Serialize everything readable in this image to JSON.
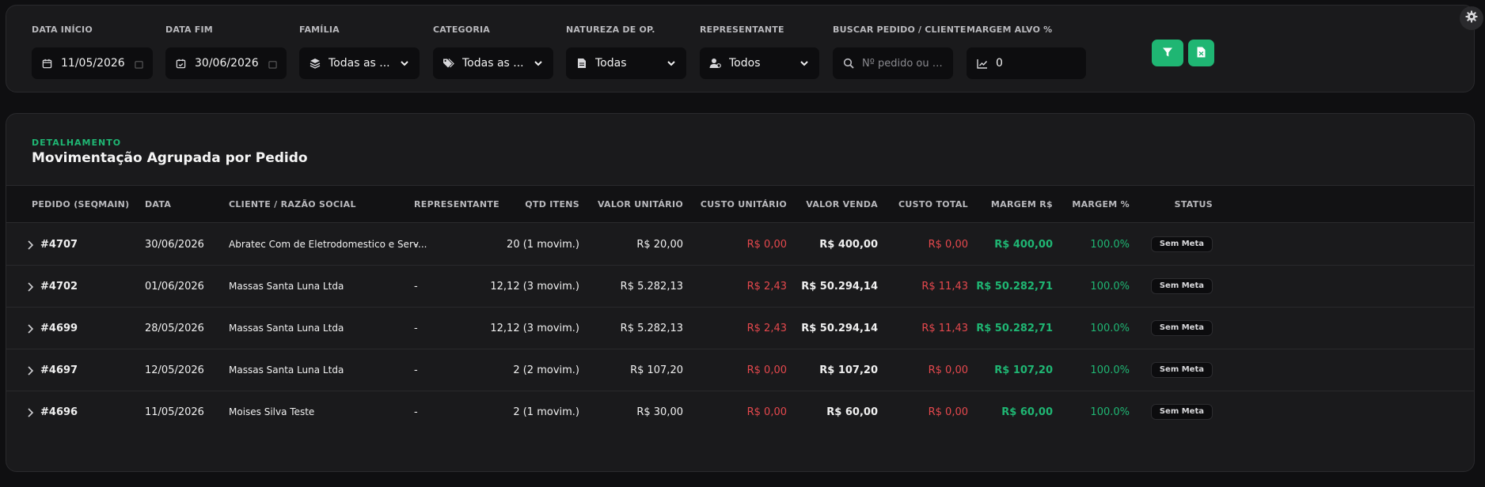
{
  "filters": {
    "data_inicio": {
      "label": "DATA INÍCIO",
      "value": "11/05/2026"
    },
    "data_fim": {
      "label": "DATA FIM",
      "value": "30/06/2026"
    },
    "familia": {
      "label": "FAMÍLIA",
      "value": "Todas as ..."
    },
    "categoria": {
      "label": "CATEGORIA",
      "value": "Todas as ..."
    },
    "natureza": {
      "label": "NATUREZA DE OP.",
      "value": "Todas"
    },
    "representante": {
      "label": "REPRESENTANTE",
      "value": "Todos"
    },
    "buscar": {
      "label": "BUSCAR PEDIDO / CLIENTE",
      "placeholder": "Nº pedido ou nome..."
    },
    "margem": {
      "label": "MARGEM ALVO %",
      "value": "0"
    }
  },
  "actions": {
    "filter_icon": "filter-icon",
    "export_icon": "excel-file-icon"
  },
  "theme": {
    "accent": "#1fb673",
    "danger": "#e5484d",
    "background": "#0f0f11",
    "card": "#1a1a1c"
  },
  "table": {
    "eyebrow": "DETALHAMENTO",
    "title": "Movimentação Agrupada por Pedido",
    "columns": {
      "pedido": "PEDIDO (SEQMAIN)",
      "data": "DATA",
      "cliente": "CLIENTE / RAZÃO SOCIAL",
      "representante": "REPRESENTANTE",
      "qtd": "QTD ITENS",
      "valor_unit": "VALOR UNITÁRIO",
      "custo_unit": "CUSTO UNITÁRIO",
      "valor_venda": "VALOR VENDA",
      "custo_total": "CUSTO TOTAL",
      "margem_rs": "MARGEM R$",
      "margem_pct": "MARGEM %",
      "status": "STATUS"
    },
    "rows": [
      {
        "pedido": "#4707",
        "data": "30/06/2026",
        "cliente": "Abratec Com de Eletrodomestico e Serv...",
        "representante": "-",
        "qtd": "20 (1 movim.)",
        "valor_unit": "R$ 20,00",
        "custo_unit": "R$ 0,00",
        "valor_venda": "R$ 400,00",
        "custo_total": "R$ 0,00",
        "margem_rs": "R$ 400,00",
        "margem_pct": "100.0%",
        "status": "Sem Meta"
      },
      {
        "pedido": "#4702",
        "data": "01/06/2026",
        "cliente": "Massas Santa Luna Ltda",
        "representante": "-",
        "qtd": "12,12 (3 movim.)",
        "valor_unit": "R$ 5.282,13",
        "custo_unit": "R$ 2,43",
        "valor_venda": "R$ 50.294,14",
        "custo_total": "R$ 11,43",
        "margem_rs": "R$ 50.282,71",
        "margem_pct": "100.0%",
        "status": "Sem Meta"
      },
      {
        "pedido": "#4699",
        "data": "28/05/2026",
        "cliente": "Massas Santa Luna Ltda",
        "representante": "-",
        "qtd": "12,12 (3 movim.)",
        "valor_unit": "R$ 5.282,13",
        "custo_unit": "R$ 2,43",
        "valor_venda": "R$ 50.294,14",
        "custo_total": "R$ 11,43",
        "margem_rs": "R$ 50.282,71",
        "margem_pct": "100.0%",
        "status": "Sem Meta"
      },
      {
        "pedido": "#4697",
        "data": "12/05/2026",
        "cliente": "Massas Santa Luna Ltda",
        "representante": "-",
        "qtd": "2 (2 movim.)",
        "valor_unit": "R$ 107,20",
        "custo_unit": "R$ 0,00",
        "valor_venda": "R$ 107,20",
        "custo_total": "R$ 0,00",
        "margem_rs": "R$ 107,20",
        "margem_pct": "100.0%",
        "status": "Sem Meta"
      },
      {
        "pedido": "#4696",
        "data": "11/05/2026",
        "cliente": "Moises Silva Teste",
        "representante": "-",
        "qtd": "2 (1 movim.)",
        "valor_unit": "R$ 30,00",
        "custo_unit": "R$ 0,00",
        "valor_venda": "R$ 60,00",
        "custo_total": "R$ 0,00",
        "margem_rs": "R$ 60,00",
        "margem_pct": "100.0%",
        "status": "Sem Meta"
      }
    ]
  }
}
